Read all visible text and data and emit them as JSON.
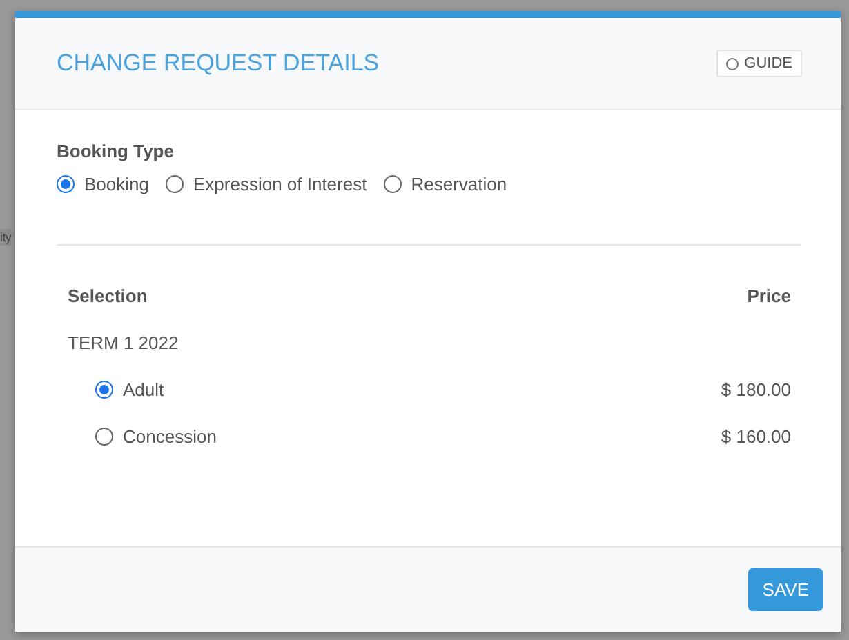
{
  "background": {
    "fragment": "ity"
  },
  "dialog": {
    "title": "CHANGE REQUEST DETAILS",
    "guide_button": "GUIDE"
  },
  "booking_type": {
    "label": "Booking Type",
    "options": [
      {
        "label": "Booking",
        "selected": true
      },
      {
        "label": "Expression of Interest",
        "selected": false
      },
      {
        "label": "Reservation",
        "selected": false
      }
    ]
  },
  "table": {
    "columns": [
      "Selection",
      "Price"
    ],
    "groups": [
      {
        "name": "TERM 1 2022",
        "rows": [
          {
            "label": "Adult",
            "price": "$ 180.00",
            "selected": true
          },
          {
            "label": "Concession",
            "price": "$ 160.00",
            "selected": false
          }
        ]
      }
    ]
  },
  "footer": {
    "buttons": [
      "SAVE"
    ]
  }
}
